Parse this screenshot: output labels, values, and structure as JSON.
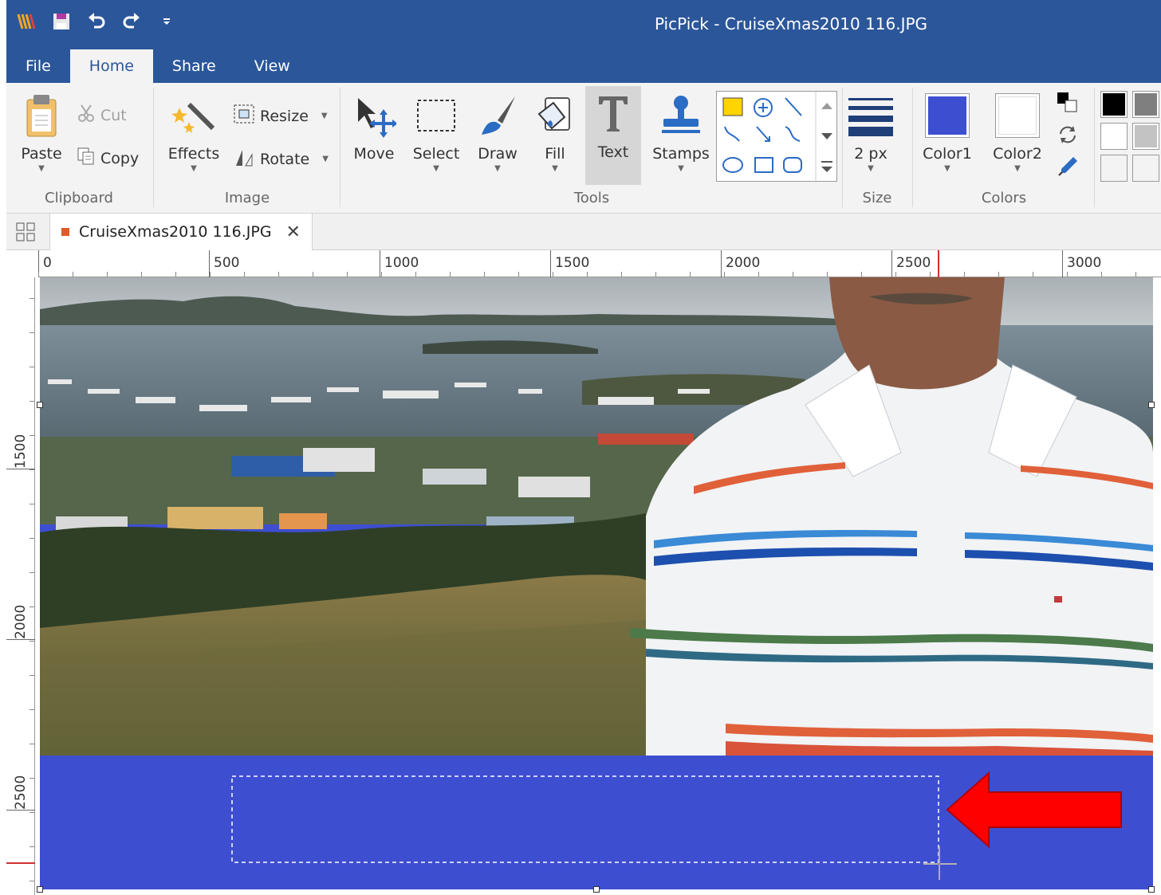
{
  "window": {
    "title": "PicPick - CruiseXmas2010 116.JPG"
  },
  "qat": {
    "icons": [
      "app-logo-icon",
      "save-icon",
      "undo-icon",
      "redo-icon",
      "customize-qat-icon"
    ]
  },
  "tabs": [
    {
      "label": "File"
    },
    {
      "label": "Home"
    },
    {
      "label": "Share"
    },
    {
      "label": "View"
    }
  ],
  "ribbon": {
    "clipboard": {
      "label": "Clipboard",
      "paste": "Paste",
      "cut": "Cut",
      "copy": "Copy"
    },
    "image": {
      "label": "Image",
      "effects": "Effects",
      "resize": "Resize",
      "rotate": "Rotate"
    },
    "tools": {
      "label": "Tools",
      "move": "Move",
      "select": "Select",
      "draw": "Draw",
      "fill": "Fill",
      "text": "Text",
      "stamps": "Stamps"
    },
    "size": {
      "label": "Size",
      "value": "2 px"
    },
    "colors": {
      "label": "Colors",
      "color1": "Color1",
      "color2": "Color2",
      "color1_value": "#3e4ed1",
      "color2_value": "#ffffff"
    }
  },
  "document": {
    "tab_label": "CruiseXmas2010 116.JPG"
  },
  "ruler": {
    "h_labels": [
      "0",
      "500",
      "1000",
      "1500",
      "2000",
      "2500",
      "3000"
    ],
    "v_labels": [
      "1500",
      "2000",
      "2500"
    ]
  },
  "colors": {
    "titlebar": "#2b569a",
    "fill_blue": "#3e4ed1",
    "arrow_red": "#ff0000"
  }
}
